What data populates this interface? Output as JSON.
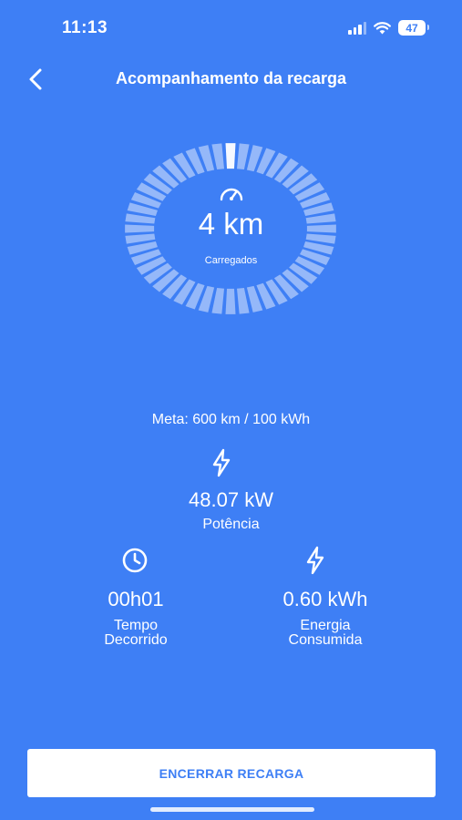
{
  "status_bar": {
    "time": "11:13",
    "battery_level": "47",
    "icons": [
      "signal-icon",
      "wifi-icon",
      "battery-icon"
    ]
  },
  "header": {
    "title": "Acompanhamento da recarga",
    "back_icon": "chevron-left-icon"
  },
  "gauge": {
    "value": "4 km",
    "caption": "Carregados",
    "icon": "speedometer-icon",
    "progress_fraction": 0.007
  },
  "goal": {
    "text": "Meta: 600 km / 100 kWh"
  },
  "power": {
    "value": "48.07 kW",
    "label": "Potência",
    "icon": "lightning-icon"
  },
  "elapsed": {
    "value": "00h01",
    "label_line1": "Tempo",
    "label_line2": "Decorrido",
    "icon": "clock-icon"
  },
  "energy": {
    "value": "0.60 kWh",
    "label_line1": "Energia",
    "label_line2": "Consumida",
    "icon": "lightning-icon"
  },
  "actions": {
    "end_label": "ENCERRAR RECARGA"
  },
  "colors": {
    "background": "#3e7ff5",
    "text": "#ffffff",
    "button_text": "#3e7ff5"
  }
}
